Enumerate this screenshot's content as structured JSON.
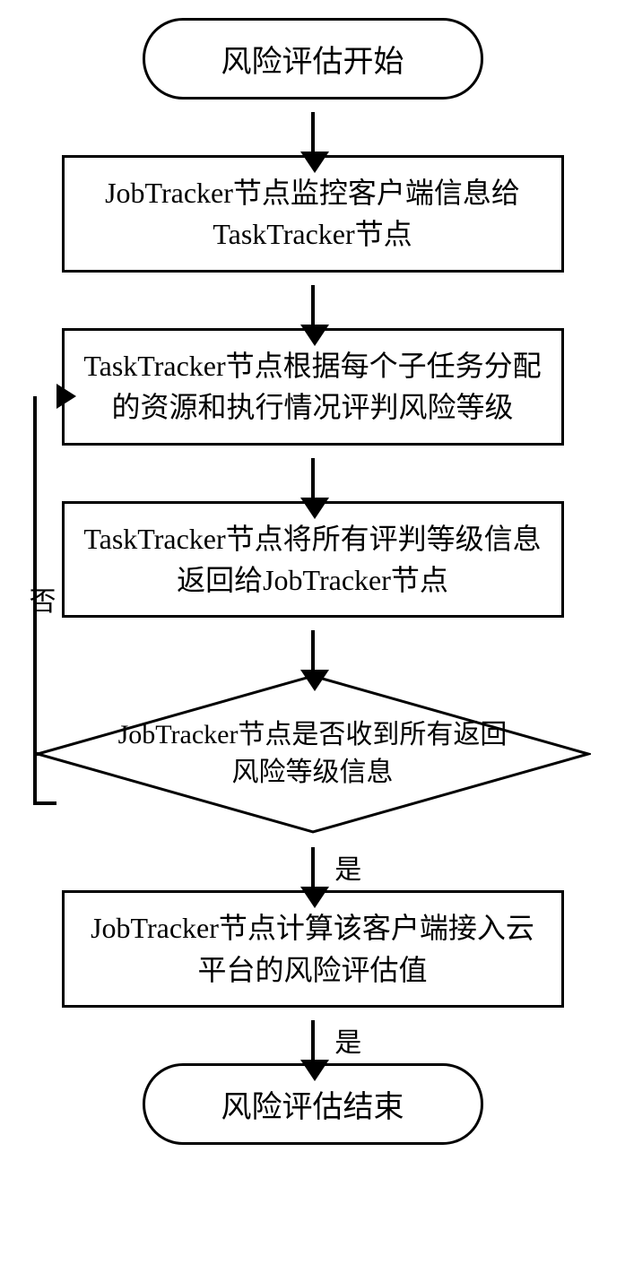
{
  "chart_data": {
    "type": "flowchart",
    "nodes": [
      {
        "id": "start",
        "type": "terminator",
        "text": "风险评估开始"
      },
      {
        "id": "p1",
        "type": "process",
        "text": "JobTracker节点监控客户端信息给TaskTracker节点"
      },
      {
        "id": "p2",
        "type": "process",
        "text": "TaskTracker节点根据每个子任务分配的资源和执行情况评判风险等级"
      },
      {
        "id": "p3",
        "type": "process",
        "text": "TaskTracker节点将所有评判等级信息返回给JobTracker节点"
      },
      {
        "id": "d1",
        "type": "decision",
        "text": "JobTracker节点是否收到所有返回风险等级信息"
      },
      {
        "id": "p4",
        "type": "process",
        "text": "JobTracker节点计算该客户端接入云平台的风险评估值"
      },
      {
        "id": "end",
        "type": "terminator",
        "text": "风险评估结束"
      }
    ],
    "edges": [
      {
        "from": "start",
        "to": "p1"
      },
      {
        "from": "p1",
        "to": "p2"
      },
      {
        "from": "p2",
        "to": "p3"
      },
      {
        "from": "p3",
        "to": "d1"
      },
      {
        "from": "d1",
        "to": "p4",
        "label": "是"
      },
      {
        "from": "d1",
        "to": "p2",
        "label": "否"
      },
      {
        "from": "p4",
        "to": "end",
        "label": "是"
      }
    ]
  },
  "labels": {
    "start": "风险评估开始",
    "p1": "JobTracker节点监控客户端信息给TaskTracker节点",
    "p2": "TaskTracker节点根据每个子任务分配的资源和执行情况评判风险等级",
    "p3": "TaskTracker节点将所有评判等级信息返回给JobTracker节点",
    "d1": "JobTracker节点是否收到所有返回风险等级信息",
    "p4": "JobTracker节点计算该客户端接入云平台的风险评估值",
    "end": "风险评估结束",
    "yes": "是",
    "no": "否"
  }
}
